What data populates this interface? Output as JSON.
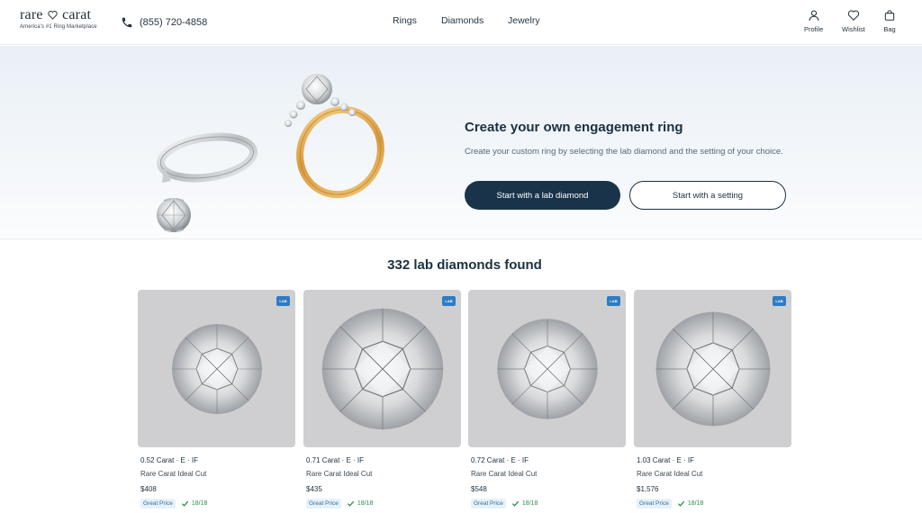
{
  "brand": {
    "name_left": "rare",
    "name_right": "carat",
    "tagline": "America's #1 Ring Marketplace"
  },
  "header": {
    "phone": "(855) 720-4858",
    "nav": [
      "Rings",
      "Diamonds",
      "Jewelry"
    ],
    "utility": {
      "profile": "Profile",
      "wishlist": "Wishlist",
      "bag": "Bag"
    }
  },
  "hero": {
    "title": "Create your own engagement ring",
    "subtitle": "Create your custom ring by selecting the lab diamond and the setting of your choice.",
    "primary_cta": "Start with a lab diamond",
    "secondary_cta": "Start with a setting"
  },
  "results": {
    "title": "332 lab diamonds found",
    "cards": [
      {
        "badge": "LAB",
        "spec": "0.52 Carat · E · IF",
        "cut": "Rare Carat Ideal Cut",
        "price": "$408",
        "tag": "Great Price",
        "score": "18/18"
      },
      {
        "badge": "LAB",
        "spec": "0.71 Carat · E · IF",
        "cut": "Rare Carat Ideal Cut",
        "price": "$435",
        "tag": "Great Price",
        "score": "18/18"
      },
      {
        "badge": "LAB",
        "spec": "0.72 Carat · E · IF",
        "cut": "Rare Carat Ideal Cut",
        "price": "$548",
        "tag": "Great Price",
        "score": "18/18"
      },
      {
        "badge": "LAB",
        "spec": "1.03 Carat · E · IF",
        "cut": "Rare Carat Ideal Cut",
        "price": "$1,576",
        "tag": "Great Price",
        "score": "18/18"
      }
    ]
  },
  "colors": {
    "primary": "#19344a",
    "badge": "#2f7cc4",
    "score_green": "#2f8a4f"
  },
  "icons": {
    "phone": "phone-icon",
    "profile": "user-icon",
    "wishlist": "heart-icon",
    "bag": "bag-icon",
    "score": "checkmark-icon"
  }
}
